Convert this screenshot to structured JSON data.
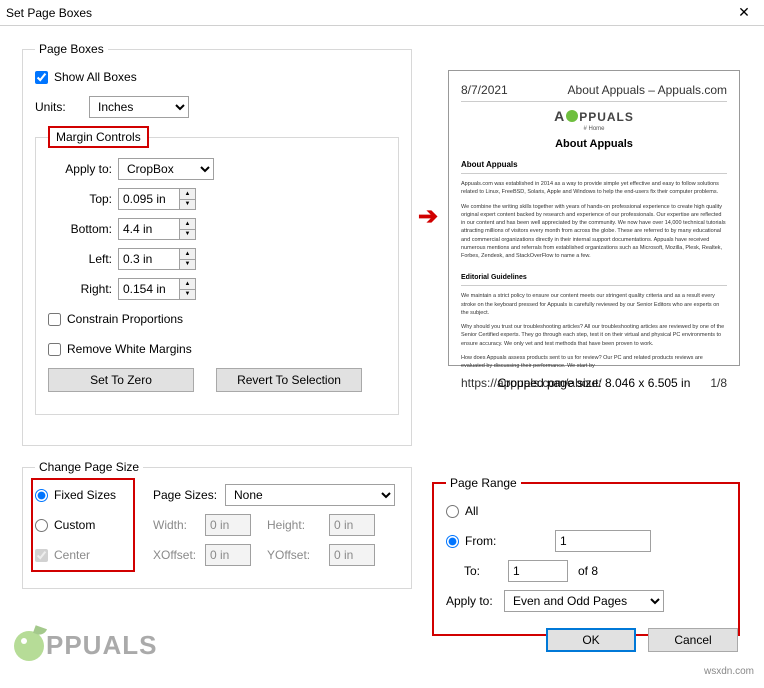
{
  "window": {
    "title": "Set Page Boxes",
    "close": "✕"
  },
  "pageBoxes": {
    "legend": "Page Boxes",
    "showAll": "Show All Boxes",
    "unitsLabel": "Units:",
    "unitsValue": "Inches",
    "margin": {
      "legend": "Margin Controls",
      "applyToLabel": "Apply to:",
      "applyToValue": "CropBox",
      "topLabel": "Top:",
      "topValue": "0.095 in",
      "bottomLabel": "Bottom:",
      "bottomValue": "4.4 in",
      "leftLabel": "Left:",
      "leftValue": "0.3 in",
      "rightLabel": "Right:",
      "rightValue": "0.154 in",
      "constrain": "Constrain Proportions",
      "removeWhite": "Remove White Margins",
      "setZero": "Set To Zero",
      "revert": "Revert To Selection"
    }
  },
  "changeSize": {
    "legend": "Change Page Size",
    "fixed": "Fixed Sizes",
    "custom": "Custom",
    "center": "Center",
    "pageSizesLabel": "Page Sizes:",
    "pageSizesValue": "None",
    "widthLabel": "Width:",
    "widthValue": "0 in",
    "heightLabel": "Height:",
    "heightValue": "0 in",
    "xoffLabel": "XOffset:",
    "xoffValue": "0 in",
    "yoffLabel": "YOffset:",
    "yoffValue": "0 in"
  },
  "pageRange": {
    "legend": "Page Range",
    "all": "All",
    "fromLabel": "From:",
    "fromValue": "1",
    "toLabel": "To:",
    "toValue": "1",
    "ofText": "of 8",
    "applyToLabel": "Apply to:",
    "applyToValue": "Even and Odd Pages"
  },
  "preview": {
    "brand": "PPUALS",
    "home": "# Home",
    "title": "About Appuals",
    "sub": "About Appuals",
    "p1": "Appuals.com was established in 2014 as a way to provide simple yet effective and easy to follow solutions related to Linux, FreeBSD, Solaris, Apple and Windows to help the end-users fix their computer problems.",
    "p2": "We combine the writing skills together with years of hands-on professional experience to create high quality original expert content backed by research and experience of our professionals. Our expertise are reflected in our content and has been well appreciated by the community. We now have over 14,000 technical tutorials attracting millions of visitors every month from across the globe. These are referred to by many educational and commercial organizations directly in their internal support documentations. Appuals have received numerous mentions and referrals from established organizations such as Microsoft, Mozilla, Plesk, Realtek, Forbes, Zendesk, and StackOverFlow to name a few.",
    "eg": "Editorial Guidelines",
    "p3": "We maintain a strict policy to ensure our content meets our stringent quality criteria and as a result every stroke on the keyboard pressed for Appuals is carefully reviewed by our Senior Editors who are experts on the subject.",
    "p4": "Why should you trust our troubleshooting articles? All our troubleshooting articles are reviewed by one of the Senior Certified experts. They go through each step, test it on their virtual and physical PC environments to ensure accuracy. We only vet and test methods that have been proven to work.",
    "p5": "How does Appuals assess products sent to us for review? Our PC and related products reviews are evaluated by discussing their performance. We start by",
    "cropSize": "Cropped page size: 8.046 x 6.505 in"
  },
  "buttons": {
    "ok": "OK",
    "cancel": "Cancel"
  },
  "watermark": {
    "text": "PPUALS",
    "site": "wsxdn.com"
  }
}
